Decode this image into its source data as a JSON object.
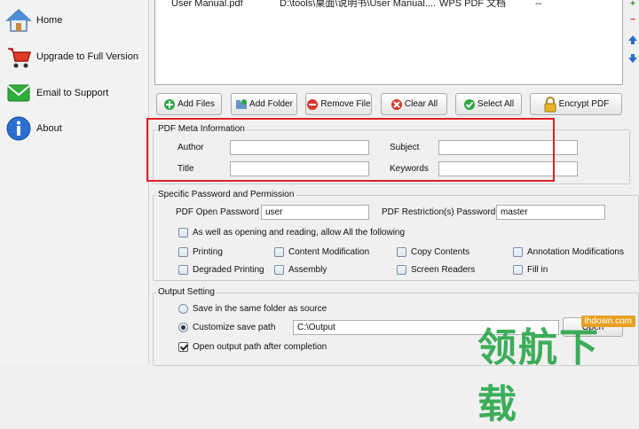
{
  "sidebar": {
    "items": [
      {
        "label": "Home",
        "icon": "home-icon"
      },
      {
        "label": "Upgrade to Full Version",
        "icon": "cart-icon"
      },
      {
        "label": "Email to Support",
        "icon": "email-icon"
      },
      {
        "label": "About",
        "icon": "info-icon"
      }
    ]
  },
  "file_list": {
    "rows": [
      {
        "name": "User Manual.pdf",
        "path": "D:\\tools\\桌面\\说明书\\User Manual....",
        "type": "WPS PDF 文档",
        "extra": "--",
        "checked": true
      }
    ]
  },
  "toolbar": {
    "add_files": "Add Files",
    "add_folder": "Add Folder",
    "remove_file": "Remove File",
    "clear_all": "Clear All",
    "select_all": "Select All",
    "encrypt_pdf": "Encrypt PDF"
  },
  "meta": {
    "title": "PDF Meta Information",
    "author_label": "Author",
    "author_value": "",
    "subject_label": "Subject",
    "subject_value": "",
    "title_label": "Title",
    "title_value": "",
    "keywords_label": "Keywords",
    "keywords_value": ""
  },
  "permission": {
    "title": "Specific Password and Permission",
    "open_password_label": "PDF Open Password",
    "open_password_value": "user",
    "restriction_label": "PDF Restriction(s) Password",
    "restriction_value": "master",
    "allow_all_label": "As well as opening and reading, allow All the following",
    "options": [
      {
        "label": "Printing",
        "checked": false
      },
      {
        "label": "Content Modification",
        "checked": false
      },
      {
        "label": "Copy Contents",
        "checked": false
      },
      {
        "label": "Annotation Modifications",
        "checked": false
      },
      {
        "label": "Degraded Printing",
        "checked": false
      },
      {
        "label": "Assembly",
        "checked": false
      },
      {
        "label": "Screen Readers",
        "checked": false
      },
      {
        "label": "Fill in",
        "checked": false
      }
    ]
  },
  "output": {
    "title": "Output Setting",
    "same_folder_label": "Save in the same folder as source",
    "custom_path_label": "Customize save path",
    "custom_path_value": "C:\\Output",
    "open_button": "Open",
    "open_after_label": "Open output path after completion",
    "selected": "custom",
    "open_after_checked": true
  },
  "watermark": {
    "text": "领航下载",
    "site": "lhdown.com"
  },
  "colors": {
    "highlight": "#e0202a",
    "add_arrow": "#2a8a2a",
    "remove_arrow": "#d02020",
    "move_arrow": "#2a6fc7"
  }
}
